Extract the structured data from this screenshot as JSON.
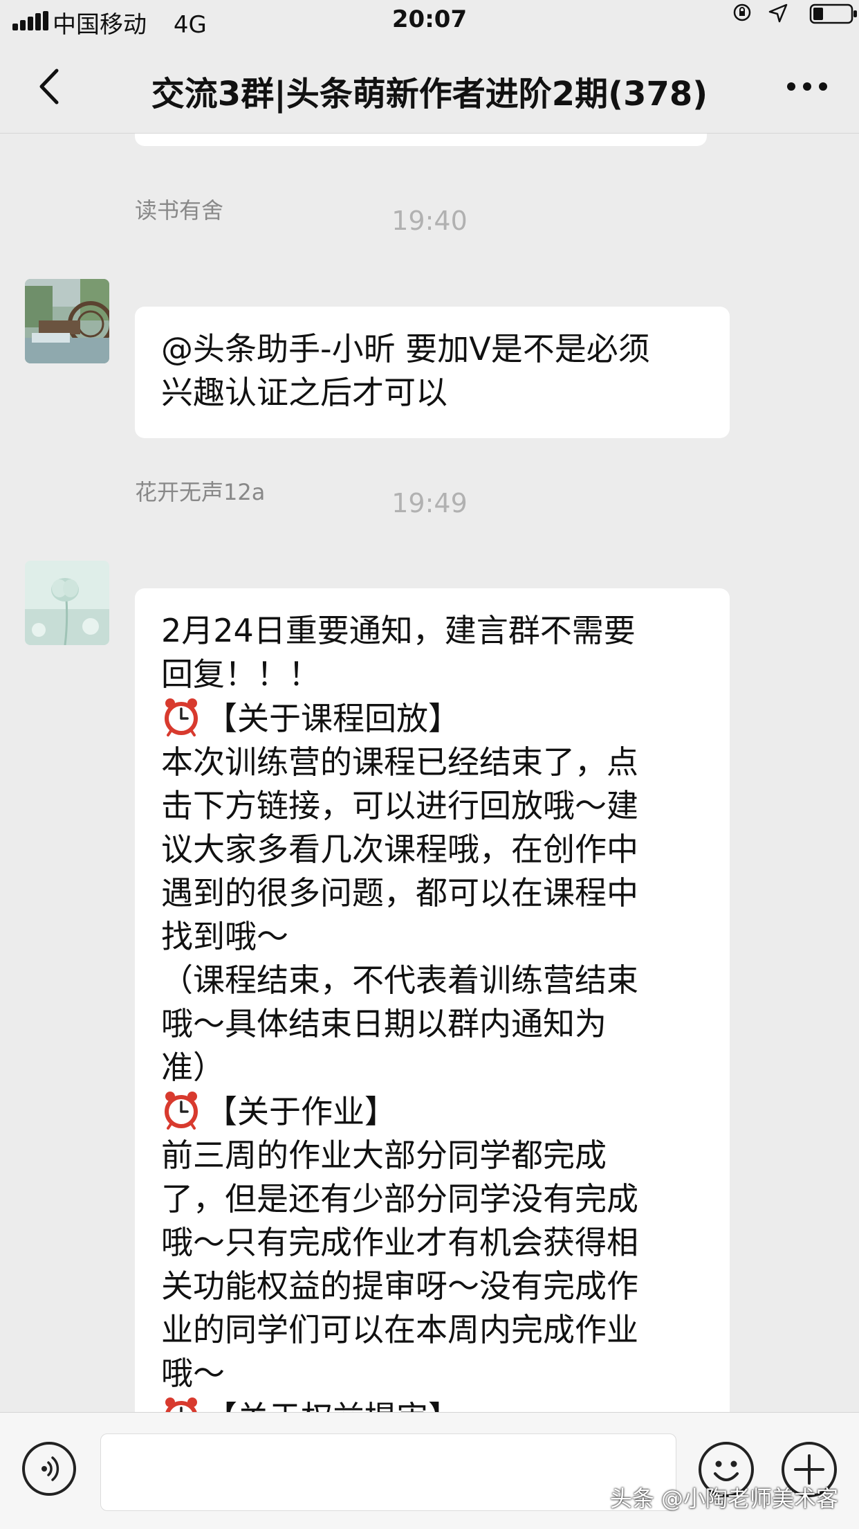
{
  "status_bar": {
    "carrier": "中国移动",
    "network": "4G",
    "time": "20:07",
    "icons": [
      "signal-icon",
      "orientation-lock-icon",
      "location-icon",
      "battery-icon"
    ]
  },
  "nav": {
    "title": "交流3群|头条萌新作者进阶2期(378)",
    "back_icon": "chevron-left-icon",
    "more_icon": "more-dots-icon"
  },
  "messages": [
    {
      "timestamp": "19:40",
      "sender": "读书有舍",
      "lines": [
        "@头条助手-小昕 要加V是不是必须",
        "兴趣认证之后才可以"
      ]
    },
    {
      "timestamp": "19:49",
      "sender": "花开无声12a",
      "lines": [
        "2月24日重要通知，建言群不需要",
        "回复！！！",
        "【关于课程回放】",
        "本次训练营的课程已经结束了，点",
        "击下方链接，可以进行回放哦～建",
        "议大家多看几次课程哦，在创作中",
        "遇到的很多问题，都可以在课程中",
        "找到哦～",
        "（课程结束，不代表着训练营结束",
        "哦～具体结束日期以群内通知为",
        "准）",
        "【关于作业】",
        "前三周的作业大部分同学都完成",
        "了，但是还有少部分同学没有完成",
        "哦～只有完成作业才有机会获得相",
        "关功能权益的提审呀～没有完成作",
        "业的同学们可以在本周内完成作业",
        "哦～",
        "【关于权益提审】"
      ]
    }
  ],
  "input_bar": {
    "placeholder": "",
    "voice_icon": "voice-icon",
    "emoji_icon": "emoji-icon",
    "plus_icon": "plus-icon"
  },
  "watermark": "头条 @小陶老师美术客",
  "colors": {
    "background": "#ececec",
    "bubble": "#ffffff",
    "timestamp": "#b1b1b1",
    "sender": "#888888"
  }
}
